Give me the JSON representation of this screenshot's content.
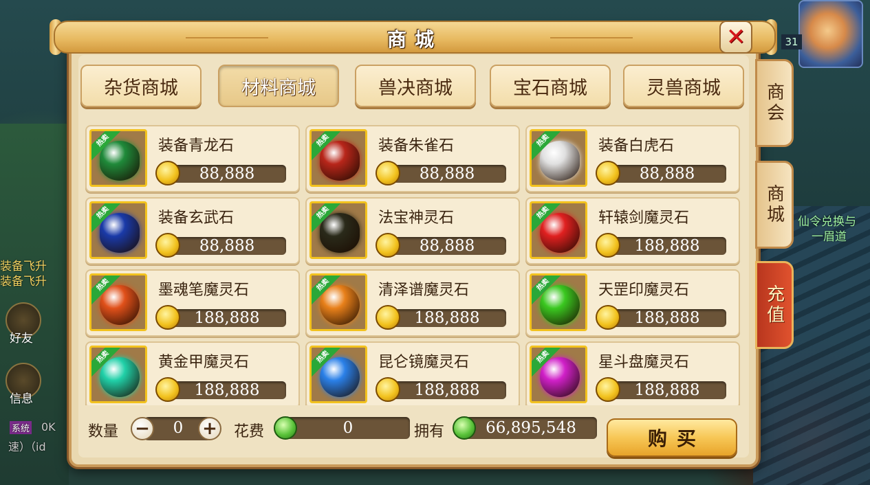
{
  "window": {
    "title": "商城"
  },
  "hud": {
    "level": "31",
    "left_labels": [
      "装备飞升",
      "装备飞升"
    ],
    "friends": "好友",
    "messages": "信息",
    "right_label_1": "仙令兑换与",
    "right_label_2": "一眉道",
    "chat_tag": "系统",
    "chat_ok": "0K",
    "chat_line": "速）（id"
  },
  "categories": [
    {
      "label": "杂货商城",
      "active": false
    },
    {
      "label": "材料商城",
      "active": true
    },
    {
      "label": "兽决商城",
      "active": false
    },
    {
      "label": "宝石商城",
      "active": false
    },
    {
      "label": "灵兽商城",
      "active": false
    }
  ],
  "side_tabs": [
    {
      "label": "商会"
    },
    {
      "label": "商城"
    },
    {
      "label": "充值"
    }
  ],
  "hot_badge": "热卖",
  "items": [
    {
      "name": "装备青龙石",
      "price": "88,888",
      "color": "#1f8a3a"
    },
    {
      "name": "装备朱雀石",
      "price": "88,888",
      "color": "#b8261a"
    },
    {
      "name": "装备白虎石",
      "price": "88,888",
      "color": "#e0e0e0"
    },
    {
      "name": "装备玄武石",
      "price": "88,888",
      "color": "#1a3aa8"
    },
    {
      "name": "法宝神灵石",
      "price": "88,888",
      "color": "#2a2a1a"
    },
    {
      "name": "轩辕剑魔灵石",
      "price": "188,888",
      "color": "#e02020"
    },
    {
      "name": "墨魂笔魔灵石",
      "price": "188,888",
      "color": "#e0501a"
    },
    {
      "name": "清泽谱魔灵石",
      "price": "188,888",
      "color": "#e8801a"
    },
    {
      "name": "天罡印魔灵石",
      "price": "188,888",
      "color": "#3ac820"
    },
    {
      "name": "黄金甲魔灵石",
      "price": "188,888",
      "color": "#20d0a8"
    },
    {
      "name": "昆仑镜魔灵石",
      "price": "188,888",
      "color": "#2a80e8"
    },
    {
      "name": "星斗盘魔灵石",
      "price": "188,888",
      "color": "#d020c8"
    }
  ],
  "bottom": {
    "qty_label": "数量",
    "qty_value": "0",
    "cost_label": "花费",
    "cost_value": "0",
    "owned_label": "拥有",
    "owned_value": "66,895,548",
    "buy_label": "购买"
  }
}
